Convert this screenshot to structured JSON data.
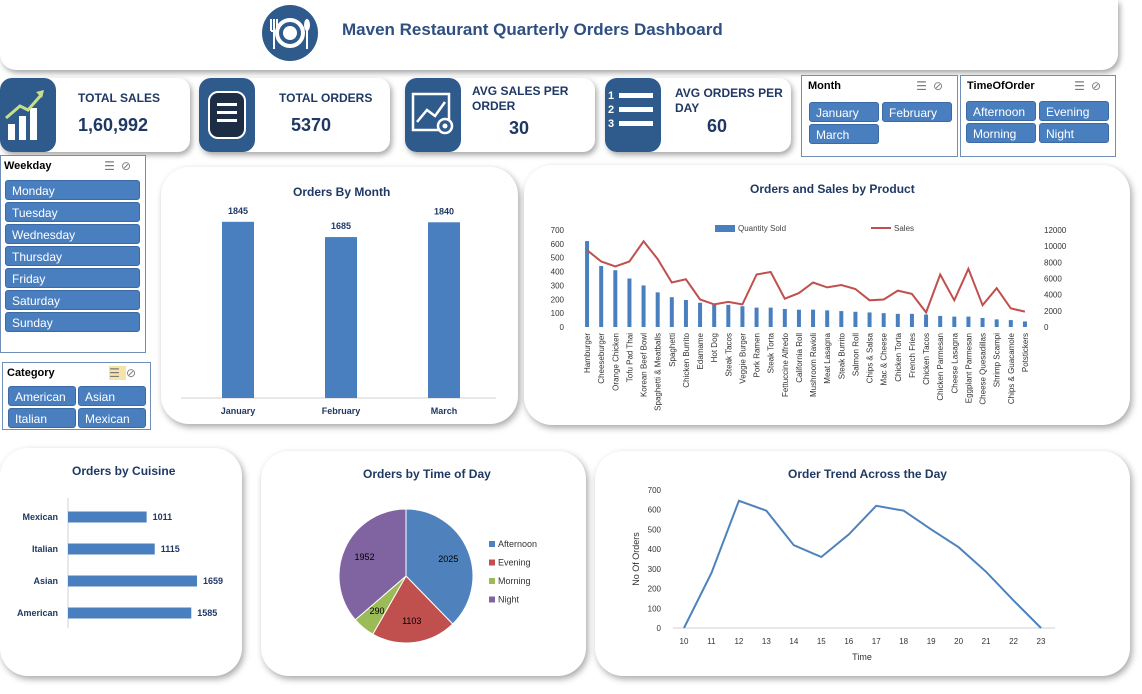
{
  "header": {
    "title": "Maven Restaurant Quarterly Orders Dashboard"
  },
  "kpis": [
    {
      "label": "TOTAL SALES",
      "value": "1,60,992"
    },
    {
      "label": "TOTAL ORDERS",
      "value": "5370"
    },
    {
      "label": "AVG SALES PER ORDER",
      "value": "30"
    },
    {
      "label": "AVG ORDERS PER DAY",
      "value": "60"
    }
  ],
  "slicers": {
    "month": {
      "title": "Month",
      "items": [
        "January",
        "February",
        "March"
      ]
    },
    "time_of_order": {
      "title": "TimeOfOrder",
      "items": [
        "Afternoon",
        "Evening",
        "Morning",
        "Night"
      ]
    },
    "weekday": {
      "title": "Weekday",
      "items": [
        "Monday",
        "Tuesday",
        "Wednesday",
        "Thursday",
        "Friday",
        "Saturday",
        "Sunday"
      ]
    },
    "category": {
      "title": "Category",
      "items": [
        "American",
        "Asian",
        "Italian",
        "Mexican"
      ]
    }
  },
  "colors": {
    "accent": "#2e5a8c",
    "bar": "#4a7fbf",
    "line": "#c0504d",
    "slicer": "#4a7fbf"
  },
  "chart_data": [
    {
      "id": "orders_by_month",
      "type": "bar",
      "title": "Orders By Month",
      "categories": [
        "January",
        "February",
        "March"
      ],
      "values": [
        1845,
        1685,
        1840
      ],
      "ylim": [
        0,
        2000
      ]
    },
    {
      "id": "orders_sales_by_product",
      "type": "bar",
      "title": "Orders and Sales by Product",
      "categories": [
        "Hamburger",
        "Cheeseburger",
        "Orange Chicken",
        "Tofu Pad Thai",
        "Korean Beef Bowl",
        "Spaghetti & Meatballs",
        "Spaghetti",
        "Chicken Burrito",
        "Edamame",
        "Hot Dog",
        "Steak Tacos",
        "Veggie Burger",
        "Pork Ramen",
        "Steak Torta",
        "Fettuccine Alfredo",
        "California Roll",
        "Mushroom Ravioli",
        "Meat Lasagna",
        "Steak Burrito",
        "Salmon Roll",
        "Chips & Salsa",
        "Mac & Cheese",
        "Chicken Torta",
        "French Fries",
        "Chicken Tacos",
        "Chicken Parmesan",
        "Cheese Lasagna",
        "Eggplant Parmesan",
        "Cheese Quesadillas",
        "Shrimp Scampi",
        "Chips & Guacamole",
        "Potstickers"
      ],
      "series": [
        {
          "name": "Quantity Sold",
          "type": "bar",
          "axis": "left",
          "values": [
            620,
            440,
            410,
            350,
            300,
            250,
            215,
            195,
            175,
            165,
            160,
            150,
            140,
            140,
            130,
            125,
            125,
            120,
            115,
            110,
            105,
            100,
            95,
            95,
            90,
            80,
            75,
            75,
            65,
            55,
            50,
            40
          ]
        },
        {
          "name": "Sales",
          "type": "line",
          "axis": "right",
          "values": [
            9500,
            8100,
            7500,
            8100,
            10600,
            8400,
            5500,
            5900,
            3400,
            2800,
            3100,
            2800,
            6500,
            6800,
            3500,
            4200,
            5500,
            4900,
            5200,
            4700,
            3300,
            3400,
            4500,
            4100,
            1800,
            6500,
            3300,
            7200,
            2700,
            4800,
            2300,
            1900
          ]
        }
      ],
      "ylim_left": [
        0,
        700
      ],
      "ylim_right": [
        0,
        12000
      ],
      "yticks_left": [
        0,
        100,
        200,
        300,
        400,
        500,
        600,
        700
      ],
      "yticks_right": [
        0,
        2000,
        4000,
        6000,
        8000,
        10000,
        12000
      ]
    },
    {
      "id": "orders_by_cuisine",
      "type": "bar",
      "orientation": "horizontal",
      "title": "Orders by Cuisine",
      "categories": [
        "Mexican",
        "Italian",
        "Asian",
        "American"
      ],
      "values": [
        1011,
        1115,
        1659,
        1585
      ]
    },
    {
      "id": "orders_by_time_of_day",
      "type": "pie",
      "title": "Orders by Time of Day",
      "categories": [
        "Afternoon",
        "Evening",
        "Morning",
        "Night"
      ],
      "values": [
        2025,
        1103,
        290,
        1952
      ],
      "colors": [
        "#4f81bd",
        "#c0504d",
        "#9bbb59",
        "#8064a2"
      ]
    },
    {
      "id": "order_trend_across_day",
      "type": "line",
      "title": "Order Trend Across the Day",
      "xlabel": "Time",
      "ylabel": "No Of Orders",
      "x": [
        10,
        11,
        12,
        13,
        14,
        15,
        16,
        17,
        18,
        19,
        20,
        21,
        22,
        23
      ],
      "values": [
        0,
        280,
        645,
        595,
        420,
        360,
        475,
        620,
        595,
        500,
        410,
        285,
        140,
        0
      ],
      "ylim": [
        0,
        700
      ],
      "yticks": [
        0,
        100,
        200,
        300,
        400,
        500,
        600,
        700
      ]
    }
  ]
}
